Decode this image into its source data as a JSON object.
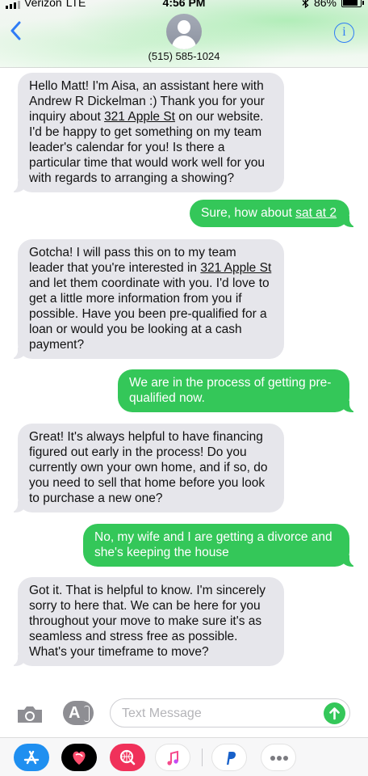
{
  "status_bar": {
    "carrier": "Verizon",
    "network": "LTE",
    "time": "4:56 PM",
    "battery": "86%"
  },
  "header": {
    "contact": "(515) 585-1024",
    "info_label": "i"
  },
  "messages": [
    {
      "direction": "incoming",
      "parts": [
        "Hello Matt! I'm Aisa, an assistant here with Andrew R Dickelman :) Thank you for your inquiry about ",
        "321 Apple St",
        " on our website. I'd be happy to get something on my team leader's calendar for you! Is there a particular time that would work well for you with regards to arranging a showing?"
      ]
    },
    {
      "direction": "outgoing",
      "parts": [
        "Sure, how about ",
        "sat at 2",
        ""
      ]
    },
    {
      "direction": "incoming",
      "parts": [
        "Gotcha! I will pass this on to my team leader that you're interested in ",
        "321 Apple St",
        " and let them coordinate with you. I'd love to get a little more information from you if possible. Have you been pre-qualified for a loan or would you be looking at a cash payment?"
      ]
    },
    {
      "direction": "outgoing",
      "parts": [
        "We are in the process of getting pre-qualified now.",
        "",
        ""
      ]
    },
    {
      "direction": "incoming",
      "parts": [
        "Great! It's always helpful to have financing figured out early in the process! Do you currently own your own home, and if so, do you need to sell that home before you look to purchase a new one?",
        "",
        ""
      ]
    },
    {
      "direction": "outgoing",
      "parts": [
        "No, my wife and I are getting a divorce and she's keeping the house",
        "",
        ""
      ]
    },
    {
      "direction": "incoming",
      "parts": [
        "Got it. That is helpful to know. I'm sincerely sorry to here that. We can be here for you throughout your move to make sure it's as seamless and stress free as possible. What's your timeframe to move?",
        "",
        ""
      ]
    }
  ],
  "composer": {
    "placeholder": "Text Message",
    "camera_icon": "camera-icon",
    "apps_icon": "app-store-icon",
    "send_icon": "send-arrow-icon"
  },
  "app_drawer": {
    "apps": [
      "app-store",
      "digital-touch",
      "images-search",
      "music",
      "paypal",
      "more"
    ],
    "colors": {
      "app_store": "#1f8ff0",
      "digital_touch": "#000000",
      "images_search": "#f0315a"
    }
  },
  "colors": {
    "incoming_bubble": "#e6e6eb",
    "outgoing_bubble": "#34c759",
    "accent": "#2f7cf6"
  }
}
